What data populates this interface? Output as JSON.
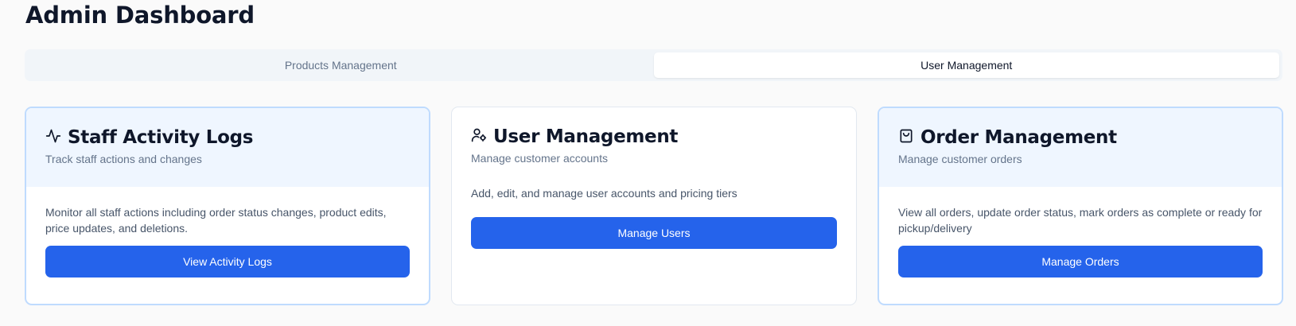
{
  "page": {
    "title": "Admin Dashboard"
  },
  "tabs": [
    {
      "label": "Products Management",
      "active": false
    },
    {
      "label": "User Management",
      "active": true
    }
  ],
  "cards": [
    {
      "icon": "activity-icon",
      "title": "Staff Activity Logs",
      "subtitle": "Track staff actions and changes",
      "description": "Monitor all staff actions including order status changes, product edits, price updates, and deletions.",
      "button": "View Activity Logs"
    },
    {
      "icon": "user-cog-icon",
      "title": "User Management",
      "subtitle": "Manage customer accounts",
      "description": "Add, edit, and manage user accounts and pricing tiers",
      "button": "Manage Users"
    },
    {
      "icon": "shopping-bag-icon",
      "title": "Order Management",
      "subtitle": "Manage customer orders",
      "description": "View all orders, update order status, mark orders as complete or ready for pickup/delivery",
      "button": "Manage Orders"
    }
  ],
  "colors": {
    "primary": "#2563eb",
    "highlight_bg": "#eff6ff",
    "highlight_border": "#bfdbfe"
  }
}
